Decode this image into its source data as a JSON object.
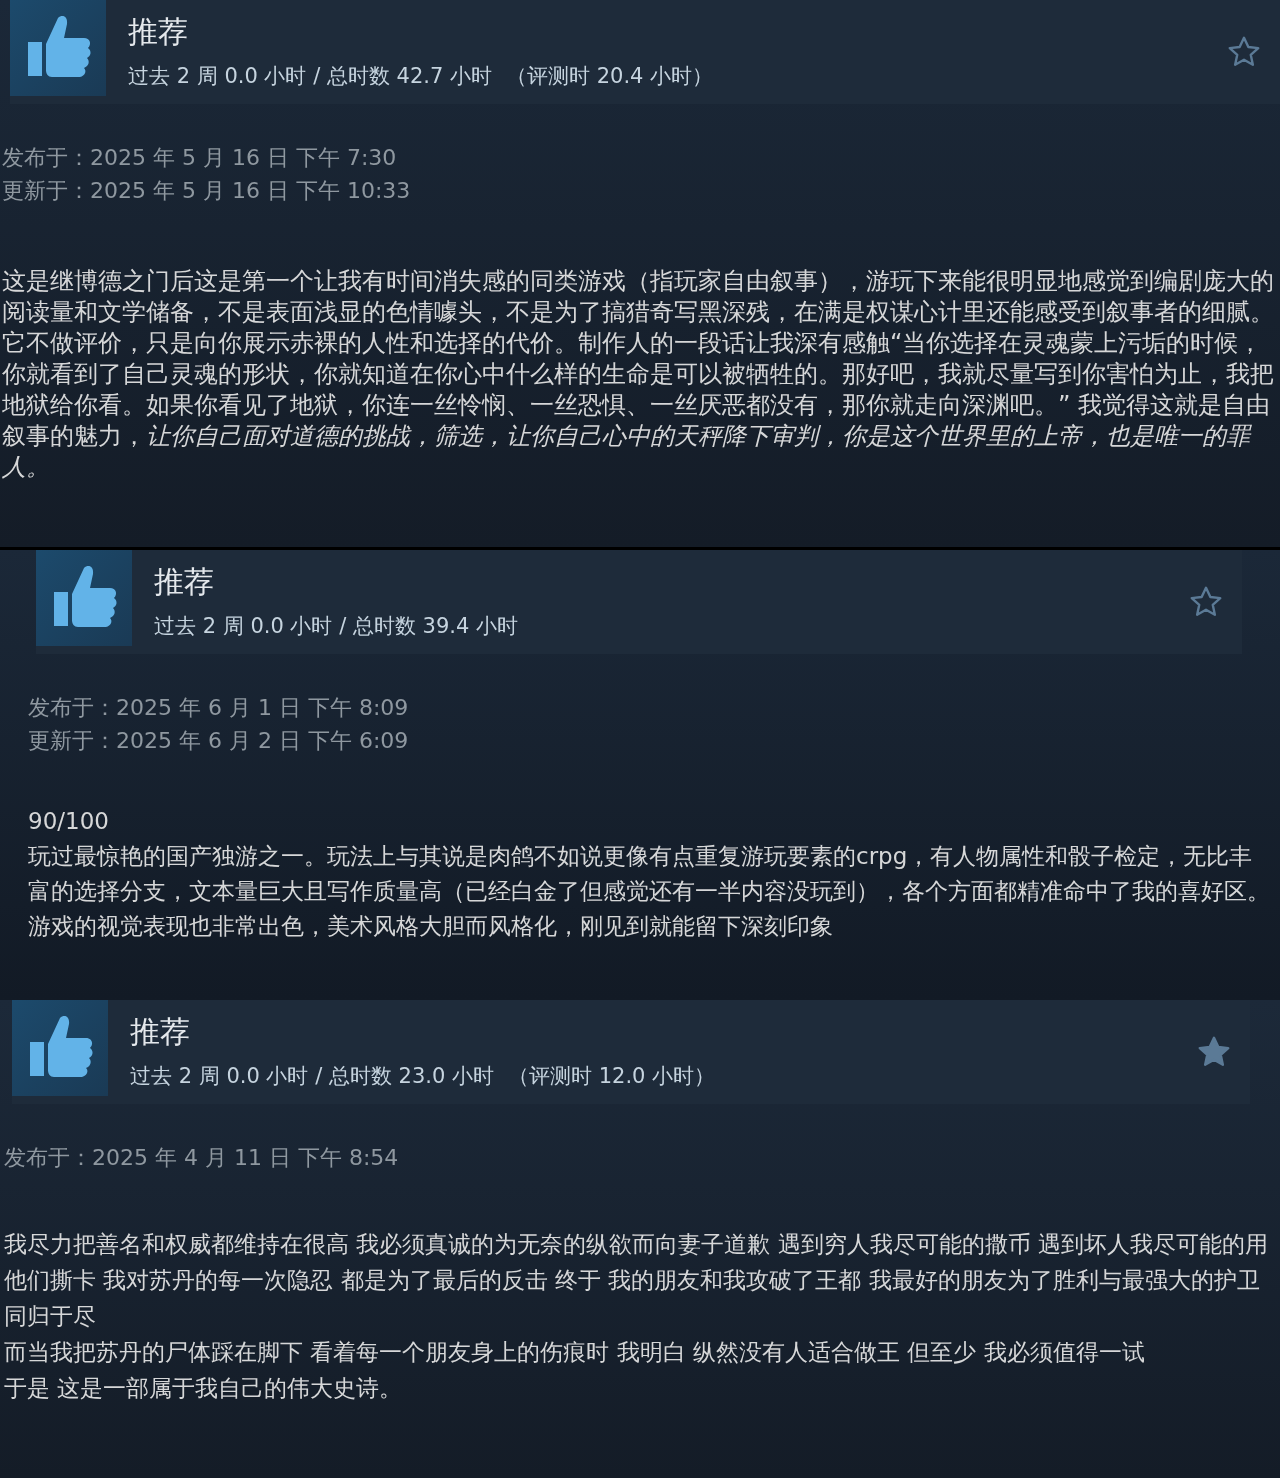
{
  "reviews": [
    {
      "verdict": "推荐",
      "hours": "过去 2 周 0.0 小时 / 总时数 42.7 小时",
      "review_hours": "（评测时 20.4 小时）",
      "starred": false,
      "dates": [
        "发布于：2025 年 5 月 16 日 下午 7:30",
        "更新于：2025 年 5 月 16 日 下午 10:33"
      ],
      "paragraphs": [
        "这是继博德之门后这是第一个让我有时间消失感的同类游戏（指玩家自由叙事），游玩下来能很明显地感觉到编剧庞大的阅读量和文学储备，不是表面浅显的色情噱头，不是为了搞猎奇写黑深残，在满是权谋心计里还能感受到叙事者的细腻。它不做评价，只是向你展示赤裸的人性和选择的代价。制作人的一段话让我深有感触“当你选择在灵魂蒙上污垢的时候，你就看到了自己灵魂的形状，你就知道在你心中什么样的生命是可以被牺牲的。那好吧，我就尽量写到你害怕为止，我把地狱给你看。如果你看见了地狱，你连一丝怜悯、一丝恐惧、一丝厌恶都没有，那你就走向深渊吧。” 我觉得这就是自由叙事的魅力，*让你自己面对道德的挑战，筛选，让你自己心中的天秤降下审判，你是这个世界里的上帝，也是唯一的罪人。*"
      ]
    },
    {
      "verdict": "推荐",
      "hours": "过去 2 周 0.0 小时 / 总时数 39.4 小时",
      "starred": false,
      "dates": [
        "发布于：2025 年 6 月 1 日 下午 8:09",
        "更新于：2025 年 6 月 2 日 下午 6:09"
      ],
      "paragraphs": [
        "90/100",
        "玩过最惊艳的国产独游之一。玩法上与其说是肉鸽不如说更像有点重复游玩要素的crpg，有人物属性和骰子检定，无比丰富的选择分支，文本量巨大且写作质量高（已经白金了但感觉还有一半内容没玩到），各个方面都精准命中了我的喜好区。游戏的视觉表现也非常出色，美术风格大胆而风格化，刚见到就能留下深刻印象"
      ]
    },
    {
      "verdict": "推荐",
      "hours": "过去 2 周 0.0 小时 / 总时数 23.0 小时",
      "review_hours": "（评测时 12.0 小时）",
      "starred": true,
      "dates": [
        "发布于：2025 年 4 月 11 日 下午 8:54"
      ],
      "paragraphs": [
        "我尽力把善名和权威都维持在很高 我必须真诚的为无奈的纵欲而向妻子道歉 遇到穷人我尽可能的撒币 遇到坏人我尽可能的用他们撕卡 我对苏丹的每一次隐忍 都是为了最后的反击 终于 我的朋友和我攻破了王都 我最好的朋友为了胜利与最强大的护卫同归于尽",
        "而当我把苏丹的尸体踩在脚下 看着每一个朋友身上的伤痕时 我明白 纵然没有人适合做王 但至少 我必须值得一试",
        "于是 这是一部属于我自己的伟大史诗。"
      ]
    }
  ]
}
